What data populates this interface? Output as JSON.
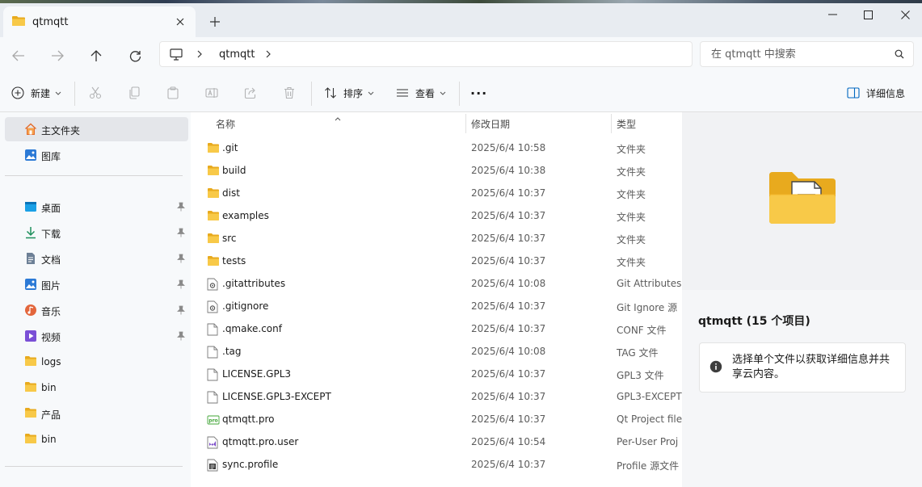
{
  "window": {
    "tab_title": "qtmqtt"
  },
  "address": {
    "crumb": "qtmqtt",
    "search_placeholder": "在 qtmqtt 中搜索"
  },
  "commands": {
    "new_label": "新建",
    "sort_label": "排序",
    "view_label": "查看",
    "more_label": "···",
    "details_label": "详细信息"
  },
  "sidebar": {
    "items": [
      {
        "label": "主文件夹",
        "icon": "home-icon",
        "selected": true
      },
      {
        "label": "图库",
        "icon": "gallery-icon"
      },
      {
        "label": "桌面",
        "icon": "desktop-icon",
        "pinned": true
      },
      {
        "label": "下载",
        "icon": "download-icon",
        "pinned": true
      },
      {
        "label": "文档",
        "icon": "document-icon",
        "pinned": true
      },
      {
        "label": "图片",
        "icon": "pictures-icon",
        "pinned": true
      },
      {
        "label": "音乐",
        "icon": "music-icon",
        "pinned": true
      },
      {
        "label": "视频",
        "icon": "video-icon",
        "pinned": true
      },
      {
        "label": "logs",
        "icon": "folder-icon"
      },
      {
        "label": "bin",
        "icon": "folder-icon"
      },
      {
        "label": "产品",
        "icon": "folder-icon"
      },
      {
        "label": "bin",
        "icon": "folder-icon"
      }
    ]
  },
  "filelist": {
    "columns": {
      "name": "名称",
      "date": "修改日期",
      "type": "类型"
    },
    "rows": [
      {
        "name": ".git",
        "date": "2025/6/4 10:58",
        "type": "文件夹",
        "icon": "folder-icon"
      },
      {
        "name": "build",
        "date": "2025/6/4 10:38",
        "type": "文件夹",
        "icon": "folder-icon"
      },
      {
        "name": "dist",
        "date": "2025/6/4 10:37",
        "type": "文件夹",
        "icon": "folder-icon"
      },
      {
        "name": "examples",
        "date": "2025/6/4 10:37",
        "type": "文件夹",
        "icon": "folder-icon"
      },
      {
        "name": "src",
        "date": "2025/6/4 10:37",
        "type": "文件夹",
        "icon": "folder-icon"
      },
      {
        "name": "tests",
        "date": "2025/6/4 10:37",
        "type": "文件夹",
        "icon": "folder-icon"
      },
      {
        "name": ".gitattributes",
        "date": "2025/6/4 10:08",
        "type": "Git Attributes",
        "icon": "settings-file-icon"
      },
      {
        "name": ".gitignore",
        "date": "2025/6/4 10:37",
        "type": "Git Ignore 源",
        "icon": "settings-file-icon"
      },
      {
        "name": ".qmake.conf",
        "date": "2025/6/4 10:37",
        "type": "CONF 文件",
        "icon": "blank-file-icon"
      },
      {
        "name": ".tag",
        "date": "2025/6/4 10:08",
        "type": "TAG 文件",
        "icon": "blank-file-icon"
      },
      {
        "name": "LICENSE.GPL3",
        "date": "2025/6/4 10:37",
        "type": "GPL3 文件",
        "icon": "blank-file-icon"
      },
      {
        "name": "LICENSE.GPL3-EXCEPT",
        "date": "2025/6/4 10:37",
        "type": "GPL3-EXCEPT",
        "icon": "blank-file-icon"
      },
      {
        "name": "qtmqtt.pro",
        "date": "2025/6/4 10:37",
        "type": "Qt Project file",
        "icon": "qt-pro-file-icon"
      },
      {
        "name": "qtmqtt.pro.user",
        "date": "2025/6/4 10:54",
        "type": "Per-User Proj",
        "icon": "visual-studio-file-icon"
      },
      {
        "name": "sync.profile",
        "date": "2025/6/4 10:37",
        "type": "Profile 源文件",
        "icon": "profile-file-icon"
      }
    ]
  },
  "details": {
    "title": "qtmqtt (15 个项目)",
    "info": "选择单个文件以获取详细信息并共享云内容。"
  },
  "colors": {
    "folder": "#f8c948",
    "folder_dark": "#e8aa1e",
    "accent": "#0067c0"
  }
}
